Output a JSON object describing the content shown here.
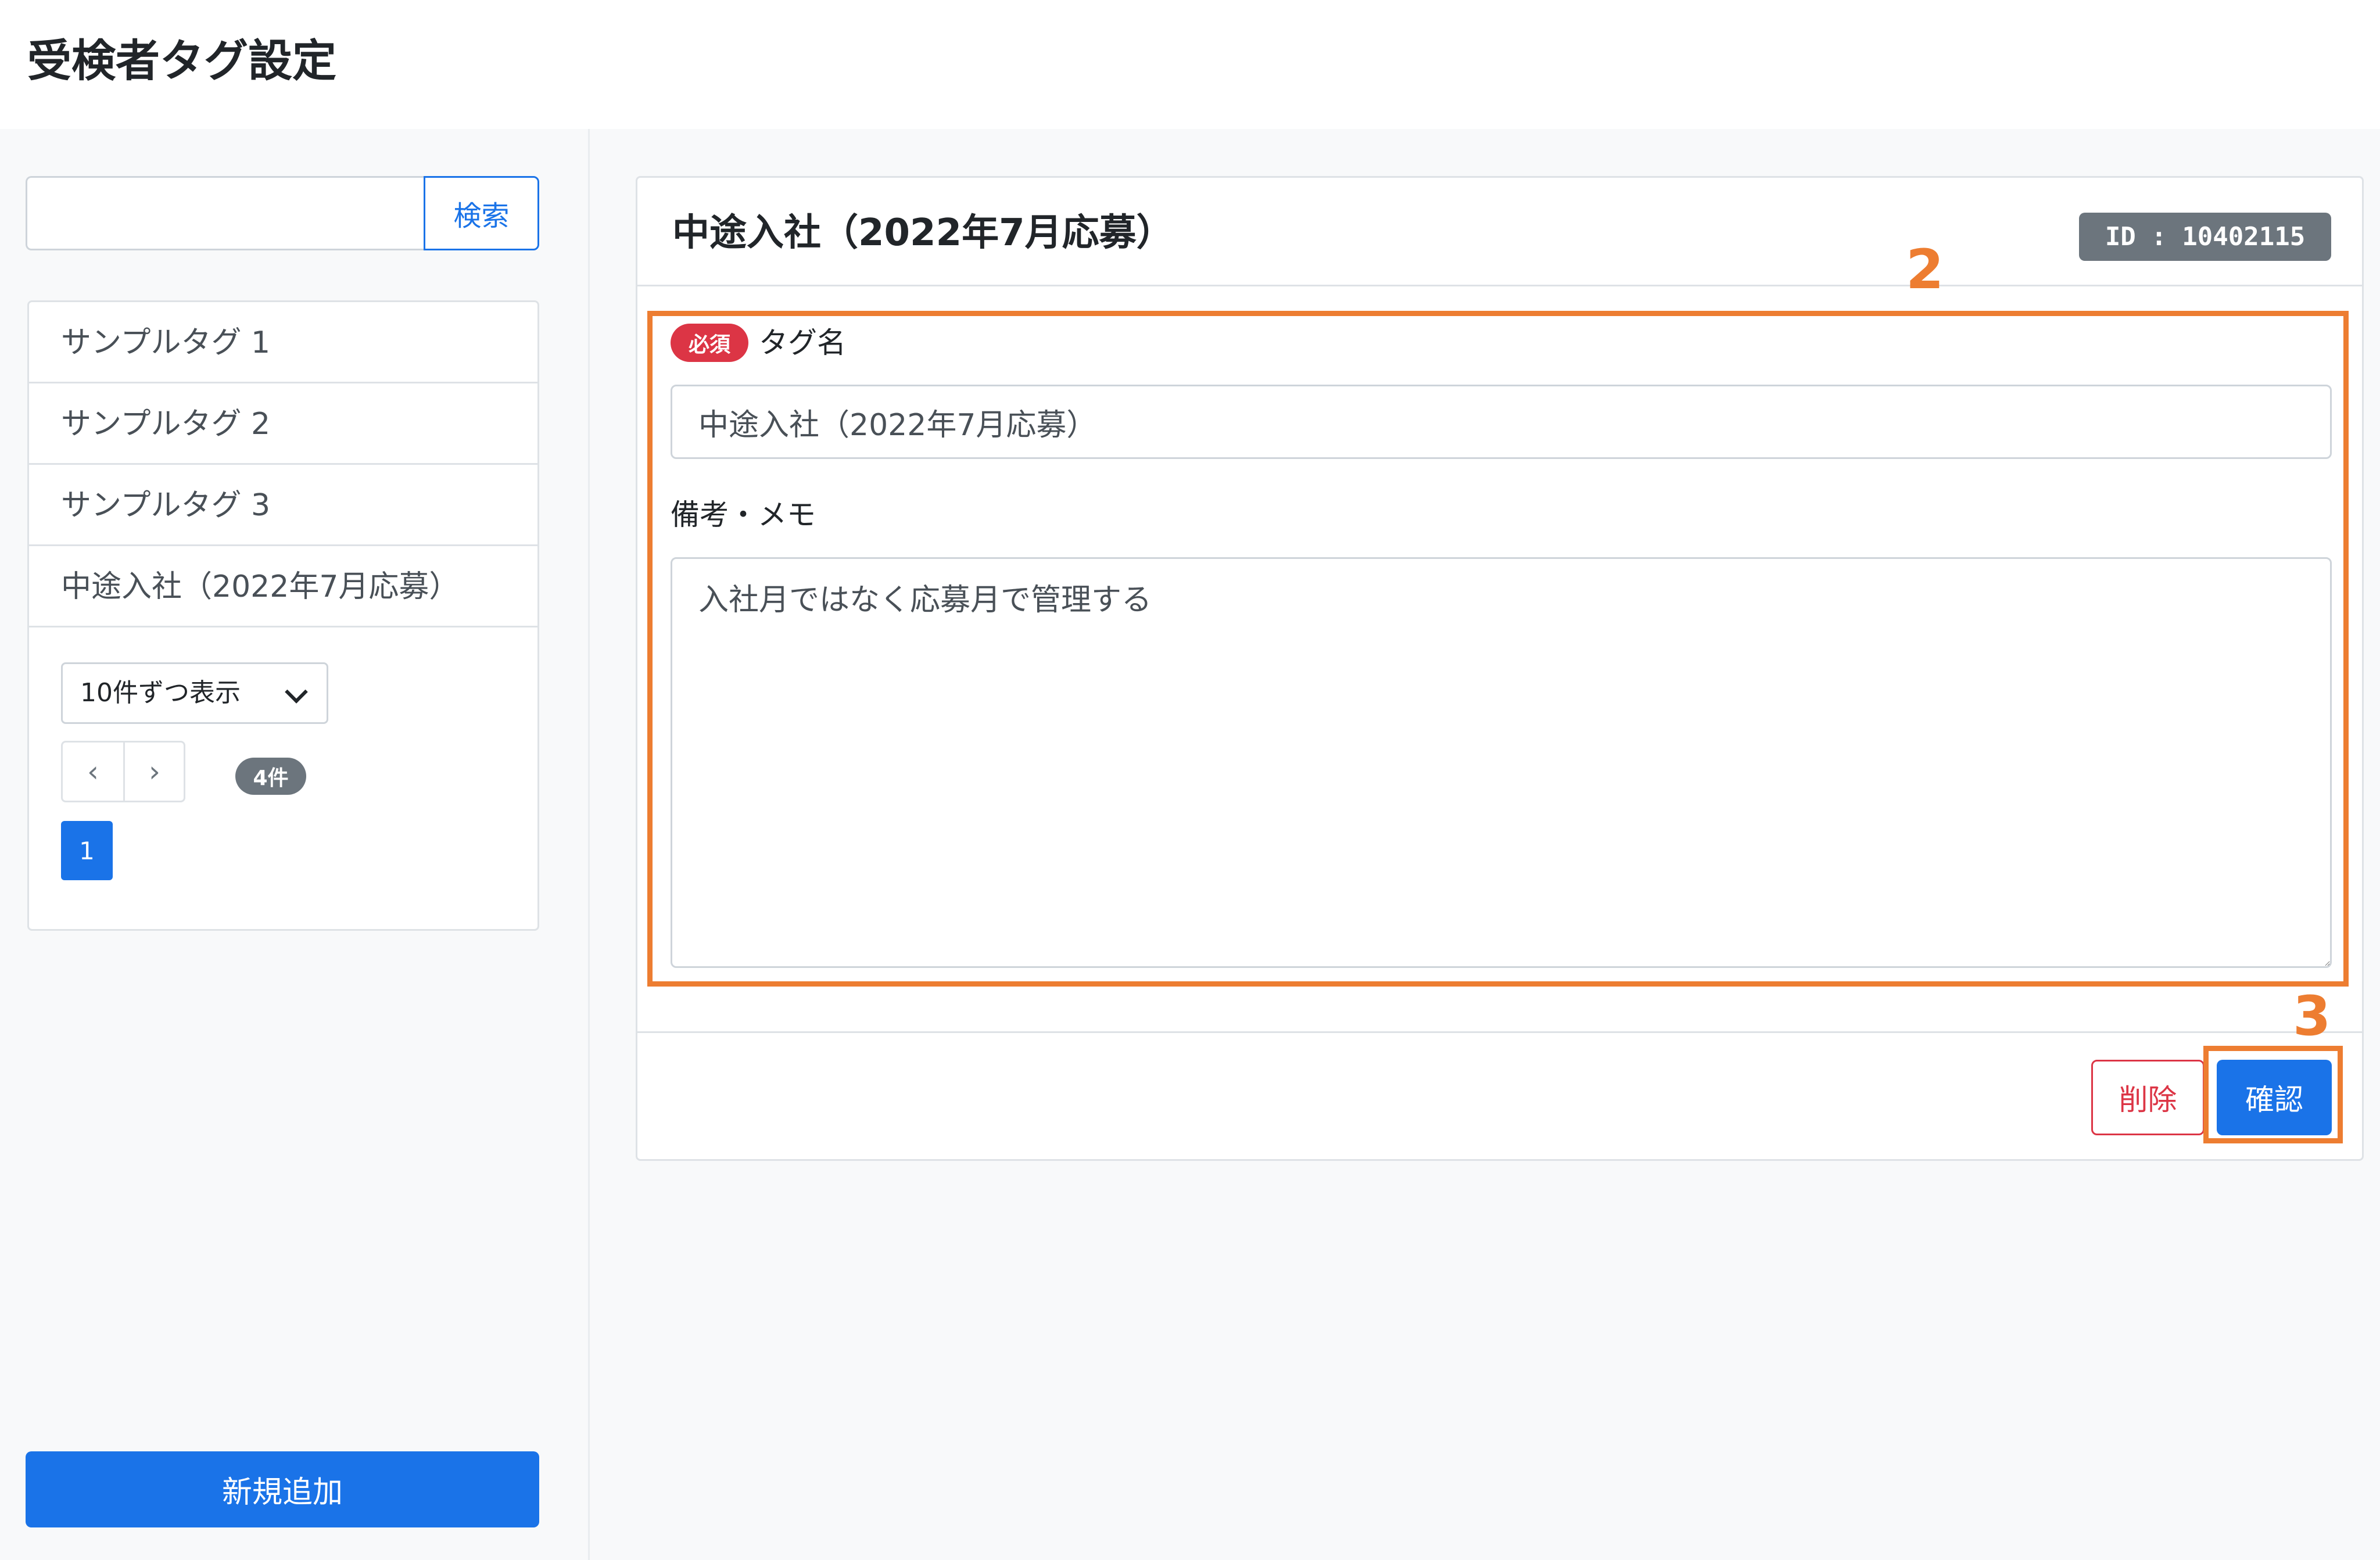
{
  "header": {
    "title": "受検者タグ設定"
  },
  "sidebar": {
    "search": {
      "placeholder": "",
      "button_label": "検索"
    },
    "tags": [
      {
        "label": "サンプルタグ 1"
      },
      {
        "label": "サンプルタグ 2"
      },
      {
        "label": "サンプルタグ 3"
      },
      {
        "label": "中途入社（2022年7月応募）"
      }
    ],
    "per_page": {
      "selected": "10件ずつ表示"
    },
    "pager": {
      "prev": "‹",
      "next": "›"
    },
    "count_badge": "4件",
    "current_page": "1",
    "add_button": "新規追加"
  },
  "detail": {
    "title": "中途入社（2022年7月応募）",
    "id_badge": "ID : 10402115",
    "required_badge": "必須",
    "tag_name_label": "タグ名",
    "tag_name_value": "中途入社（2022年7月応募）",
    "memo_label": "備考・メモ",
    "memo_value": "入社月ではなく応募月で管理する",
    "delete_button": "削除",
    "confirm_button": "確認"
  },
  "annotations": {
    "step_2": "2",
    "step_3": "3"
  },
  "colors": {
    "accent": "#1a73e8",
    "danger": "#dc3545",
    "badge_gray": "#6c757d",
    "annotation": "#ed7d31",
    "page_bg": "#f8f9fa"
  }
}
